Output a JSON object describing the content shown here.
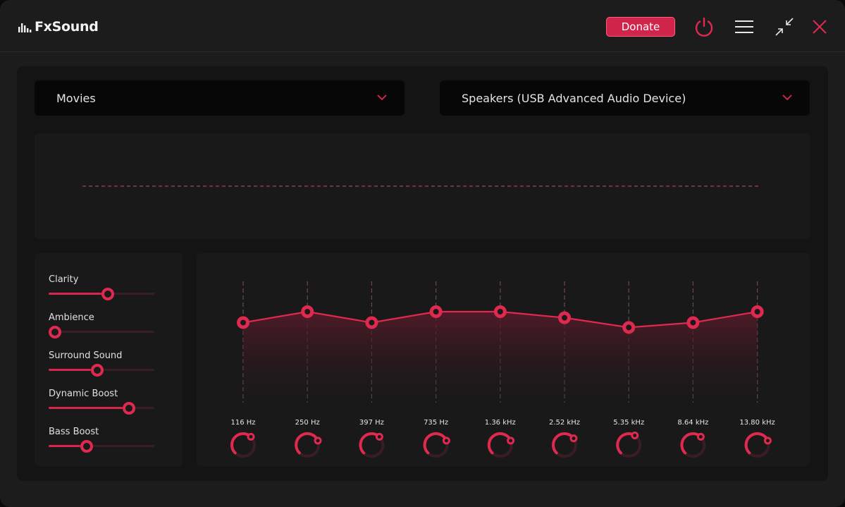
{
  "app": {
    "name": "FxSound"
  },
  "toolbar": {
    "donate_label": "Donate",
    "icons": [
      "power-icon",
      "menu-icon",
      "minimize-icon",
      "close-icon"
    ],
    "accent_color": "#d1244a"
  },
  "preset": {
    "selected": "Movies"
  },
  "output_device": {
    "selected": "Speakers (USB Advanced Audio Device)"
  },
  "effects": [
    {
      "label": "Clarity",
      "value": 0.5
    },
    {
      "label": "Ambience",
      "value": 0.0
    },
    {
      "label": "Surround Sound",
      "value": 0.4
    },
    {
      "label": "Dynamic Boost",
      "value": 0.7
    },
    {
      "label": "Bass Boost",
      "value": 0.3
    }
  ],
  "equalizer": {
    "bands": [
      {
        "freq": "116 Hz",
        "gain": 0.66
      },
      {
        "freq": "250 Hz",
        "gain": 0.75
      },
      {
        "freq": "397 Hz",
        "gain": 0.66
      },
      {
        "freq": "735 Hz",
        "gain": 0.75
      },
      {
        "freq": "1.36 kHz",
        "gain": 0.75
      },
      {
        "freq": "2.52 kHz",
        "gain": 0.7
      },
      {
        "freq": "5.35 kHz",
        "gain": 0.62
      },
      {
        "freq": "8.64 kHz",
        "gain": 0.66
      },
      {
        "freq": "13.80 kHz",
        "gain": 0.75
      }
    ]
  }
}
